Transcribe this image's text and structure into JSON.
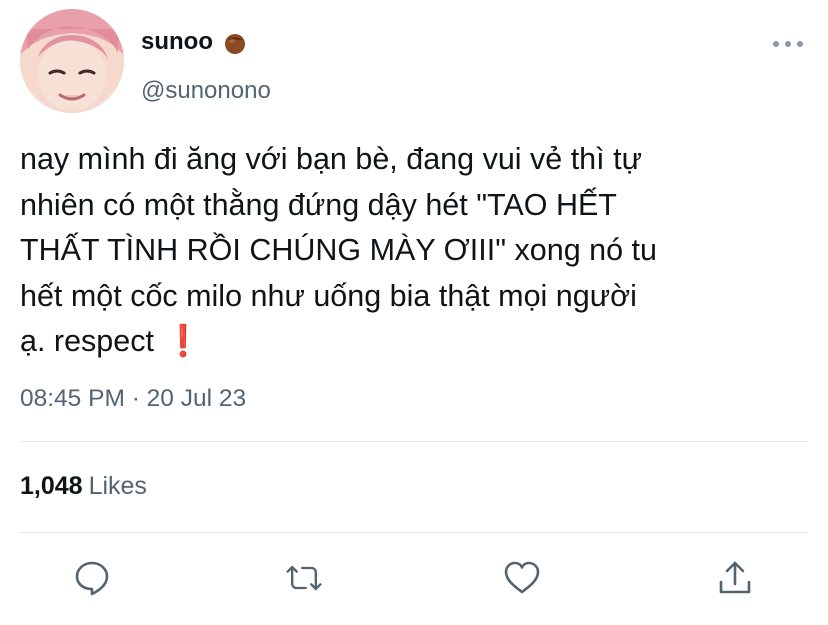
{
  "author": {
    "display_name": "sunoo",
    "emoji_icon": "chestnut-emoji",
    "handle": "@sunonono"
  },
  "tweet": {
    "lines": [
      "nay mình đi ăng với bạn bè, đang vui vẻ thì tự",
      "nhiên có một thằng đứng dậy hét \"TAO HẾT",
      "THẤT TÌNH RỒI CHÚNG MÀY ƠIII\" xong nó tu",
      "hết một cốc milo như uống bia thật mọi người",
      "ạ. respect"
    ],
    "trailing_emoji": "❗"
  },
  "meta": {
    "time": "08:45 PM",
    "separator": "·",
    "date": "20 Jul 23"
  },
  "stats": {
    "likes_count": "1,048",
    "likes_label": "Likes"
  },
  "actions": {
    "icons": [
      "reply-icon",
      "retweet-icon",
      "like-icon",
      "share-icon"
    ]
  },
  "colors": {
    "text": "#0f1419",
    "secondary": "#536471",
    "icon": "#536471",
    "divider": "#e1e6ea",
    "exclamation": "#e0245e"
  }
}
